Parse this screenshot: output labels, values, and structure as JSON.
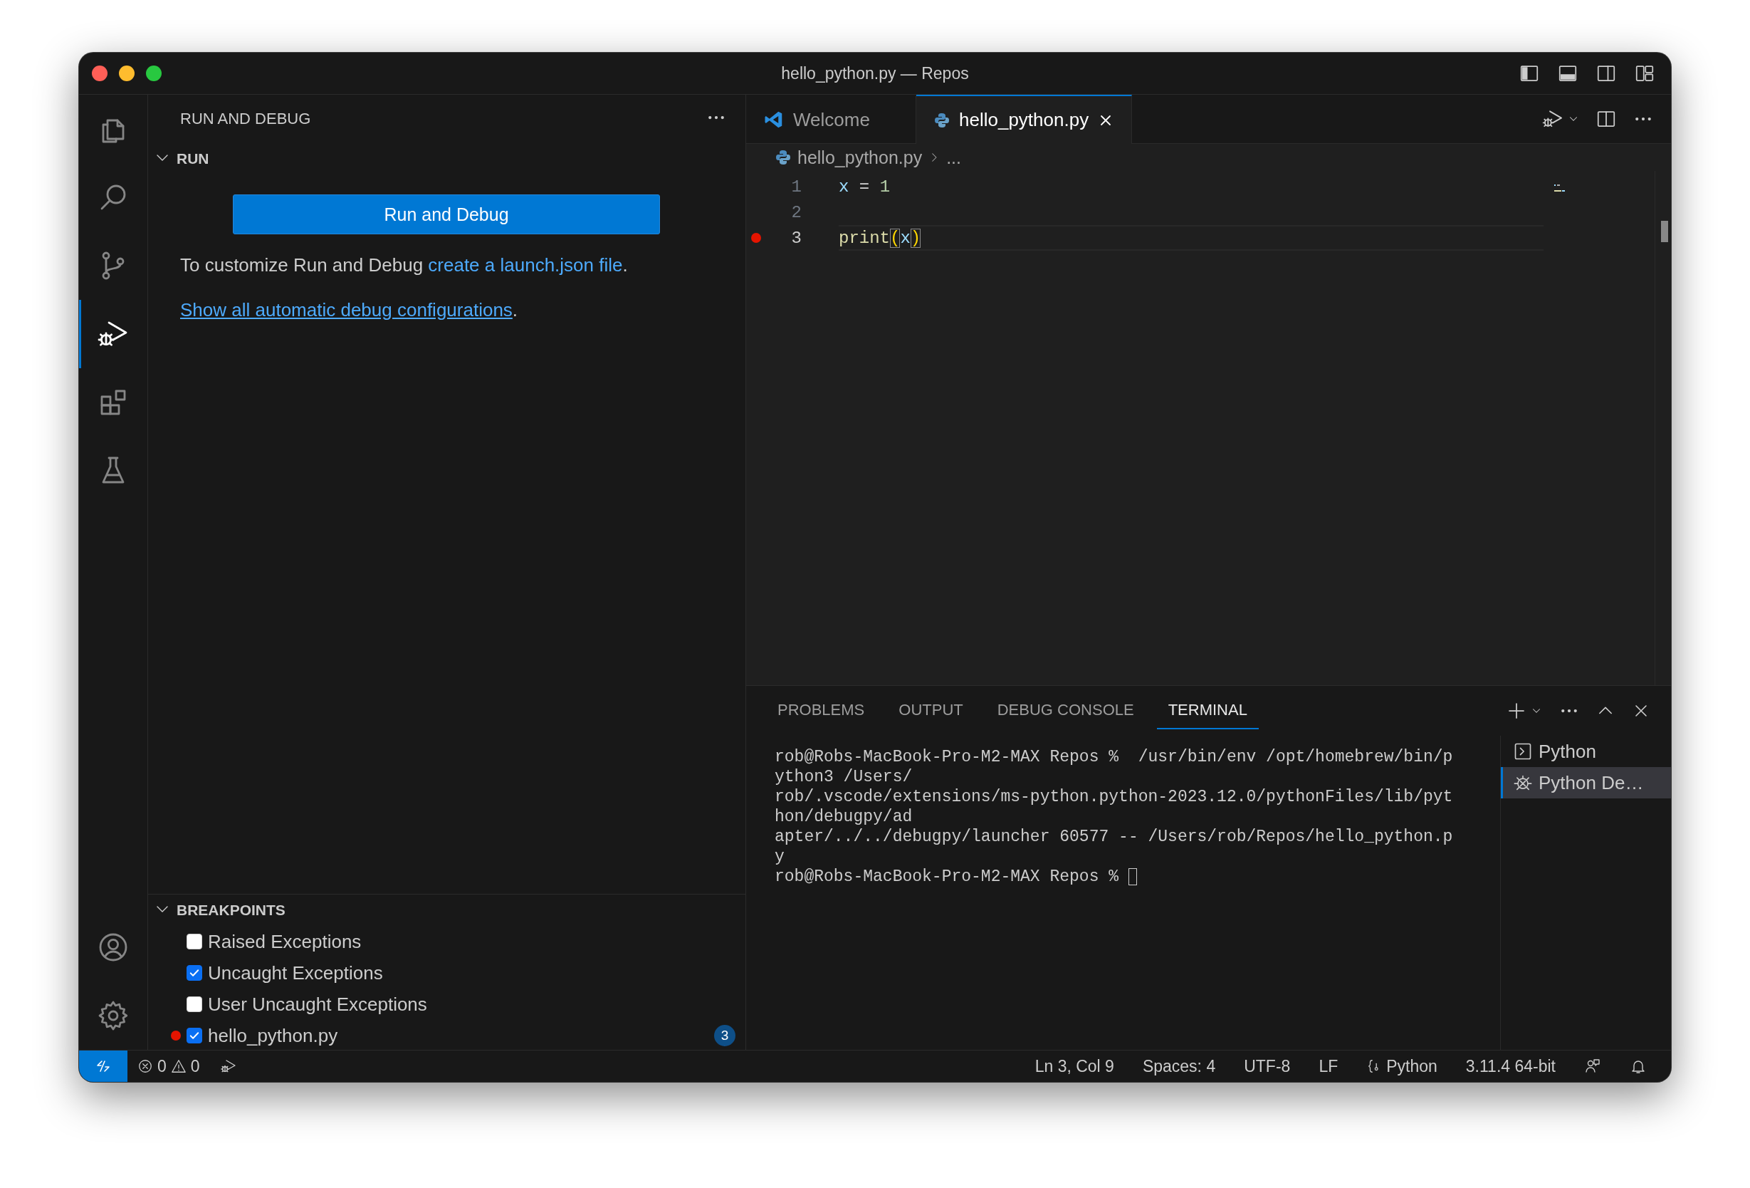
{
  "window": {
    "title": "hello_python.py — Repos"
  },
  "activity_bar": {
    "top": [
      {
        "kind": "files",
        "selected": false
      },
      {
        "kind": "search",
        "selected": false
      },
      {
        "kind": "branch",
        "selected": false
      },
      {
        "kind": "debug",
        "selected": true
      },
      {
        "kind": "extensions",
        "selected": false
      },
      {
        "kind": "flask",
        "selected": false
      }
    ],
    "bottom": [
      {
        "kind": "account",
        "selected": false
      },
      {
        "kind": "gear",
        "selected": false
      }
    ]
  },
  "sidebar": {
    "title": "RUN AND DEBUG",
    "run": {
      "title": "RUN",
      "expanded": true,
      "button": "Run and Debug",
      "text": "To customize Run and Debug ",
      "link": "create a launch.json file",
      "text_end": ".",
      "link2": "Show all automatic debug configurations",
      "link2_end": "."
    },
    "breakpoints": {
      "title": "BREAKPOINTS",
      "expanded": true,
      "items": [
        {
          "kind": "exception",
          "label": "Raised Exceptions",
          "checked": false
        },
        {
          "kind": "exception",
          "label": "Uncaught Exceptions",
          "checked": true
        },
        {
          "kind": "exception",
          "label": "User Uncaught Exceptions",
          "checked": false
        },
        {
          "kind": "file",
          "label": "hello_python.py",
          "checked": true,
          "badge": "3"
        }
      ]
    }
  },
  "editor": {
    "tabs": [
      {
        "kind": "welcome",
        "label": "Welcome",
        "selected": false
      },
      {
        "kind": "python",
        "label": "hello_python.py",
        "selected": true
      }
    ],
    "breadcrumbs": [
      "hello_python.py",
      "..."
    ],
    "lines": [
      {
        "number": "1",
        "breakpoint": false,
        "current": false,
        "tokens": [
          {
            "kind": "var",
            "text": "x"
          },
          {
            "kind": "op",
            "text": " = "
          },
          {
            "kind": "num",
            "text": "1"
          }
        ]
      },
      {
        "number": "2",
        "breakpoint": false,
        "current": false
      },
      {
        "number": "3",
        "breakpoint": true,
        "current": true,
        "tokens": [
          {
            "kind": "func",
            "text": "print"
          },
          {
            "kind": "bracket",
            "text": "("
          },
          {
            "kind": "var",
            "text": "x"
          },
          {
            "kind": "bracket",
            "text": ")"
          }
        ]
      }
    ]
  },
  "panel": {
    "tabs": [
      {
        "label": "PROBLEMS",
        "selected": false
      },
      {
        "label": "OUTPUT",
        "selected": false
      },
      {
        "label": "DEBUG CONSOLE",
        "selected": false
      },
      {
        "label": "TERMINAL",
        "selected": true
      }
    ],
    "terminal_lines": [
      "rob@Robs-MacBook-Pro-M2-MAX Repos %  /usr/bin/env /opt/homebrew/bin/p",
      "ython3 /Users/",
      "rob/.vscode/extensions/ms-python.python-2023.12.0/pythonFiles/lib/pyt",
      "hon/debugpy/ad",
      "apter/../../debugpy/launcher 60577 -- /Users/rob/Repos/hello_python.p",
      "y",
      "rob@Robs-MacBook-Pro-M2-MAX Repos % "
    ],
    "terminals": [
      {
        "kind": "shell",
        "label": "Python",
        "selected": false
      },
      {
        "kind": "debug",
        "label": "Python De…",
        "selected": true
      }
    ]
  },
  "status_bar": {
    "left": [
      {
        "kind": "remote"
      },
      {
        "kind": "problems",
        "errors": "0",
        "warnings": "0"
      },
      {
        "kind": "debug"
      }
    ],
    "right": [
      {
        "kind": "text",
        "text": "Ln 3, Col 9"
      },
      {
        "kind": "text",
        "text": "Spaces: 4"
      },
      {
        "kind": "text",
        "text": "UTF-8"
      },
      {
        "kind": "text",
        "text": "LF"
      },
      {
        "kind": "language",
        "text": "Python"
      },
      {
        "kind": "text",
        "text": "3.11.4 64-bit"
      },
      {
        "kind": "feedback"
      },
      {
        "kind": "bell"
      }
    ]
  }
}
